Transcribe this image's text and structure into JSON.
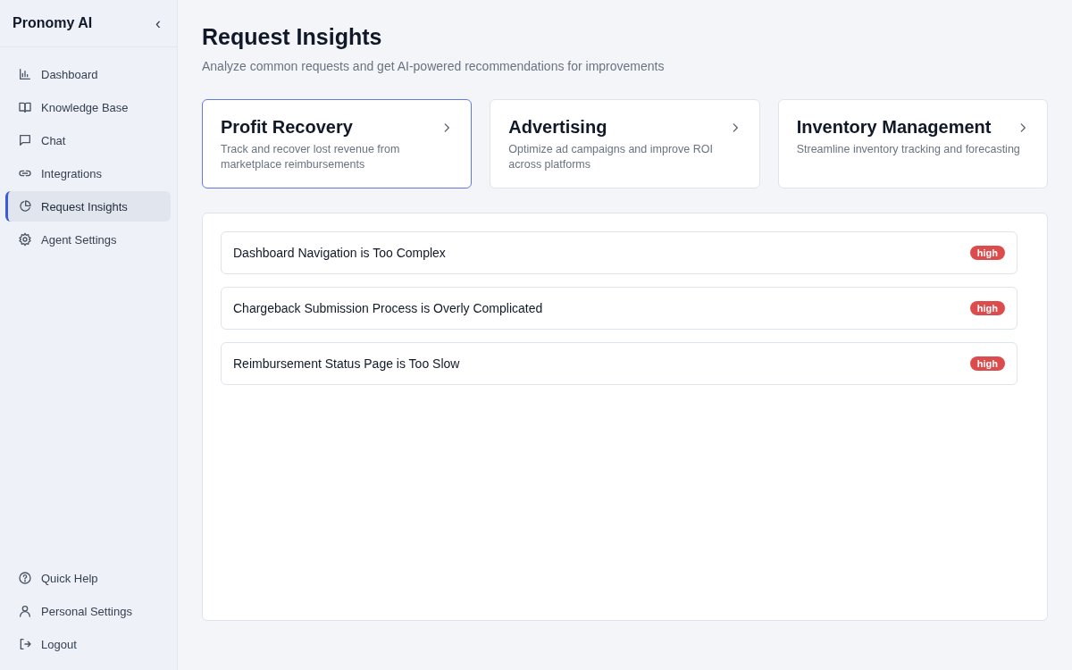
{
  "sidebar": {
    "brand": "Pronomy AI",
    "collapse_icon": "‹",
    "items": [
      {
        "label": "Dashboard",
        "kind": "chart",
        "selected": false
      },
      {
        "label": "Knowledge Base",
        "kind": "book",
        "selected": false
      },
      {
        "label": "Chat",
        "kind": "chat",
        "selected": false
      },
      {
        "label": "Integrations",
        "kind": "link",
        "selected": false
      },
      {
        "label": "Request Insights",
        "kind": "pie",
        "selected": true
      },
      {
        "label": "Agent Settings",
        "kind": "gear",
        "selected": false
      }
    ],
    "footer_items": [
      {
        "label": "Quick Help",
        "kind": "help"
      },
      {
        "label": "Personal Settings",
        "kind": "user"
      },
      {
        "label": "Logout",
        "kind": "logout"
      }
    ]
  },
  "page": {
    "title": "Request Insights",
    "subtitle": "Analyze common requests and get AI-powered recommendations for improvements"
  },
  "categories": [
    {
      "title": "Profit Recovery",
      "description": "Track and recover lost revenue from marketplace reimbursements",
      "selected": true
    },
    {
      "title": "Advertising",
      "description": "Optimize ad campaigns and improve ROI across platforms",
      "selected": false
    },
    {
      "title": "Inventory Management",
      "description": "Streamline inventory tracking and forecasting",
      "selected": false
    }
  ],
  "insights": [
    {
      "title": "Dashboard Navigation is Too Complex",
      "priority": "high",
      "color": "#dc4c4c"
    },
    {
      "title": "Chargeback Submission Process is Overly Complicated",
      "priority": "high",
      "color": "#dc4c4c"
    },
    {
      "title": "Reimbursement Status Page is Too Slow",
      "priority": "high",
      "color": "#dc4c4c"
    }
  ]
}
